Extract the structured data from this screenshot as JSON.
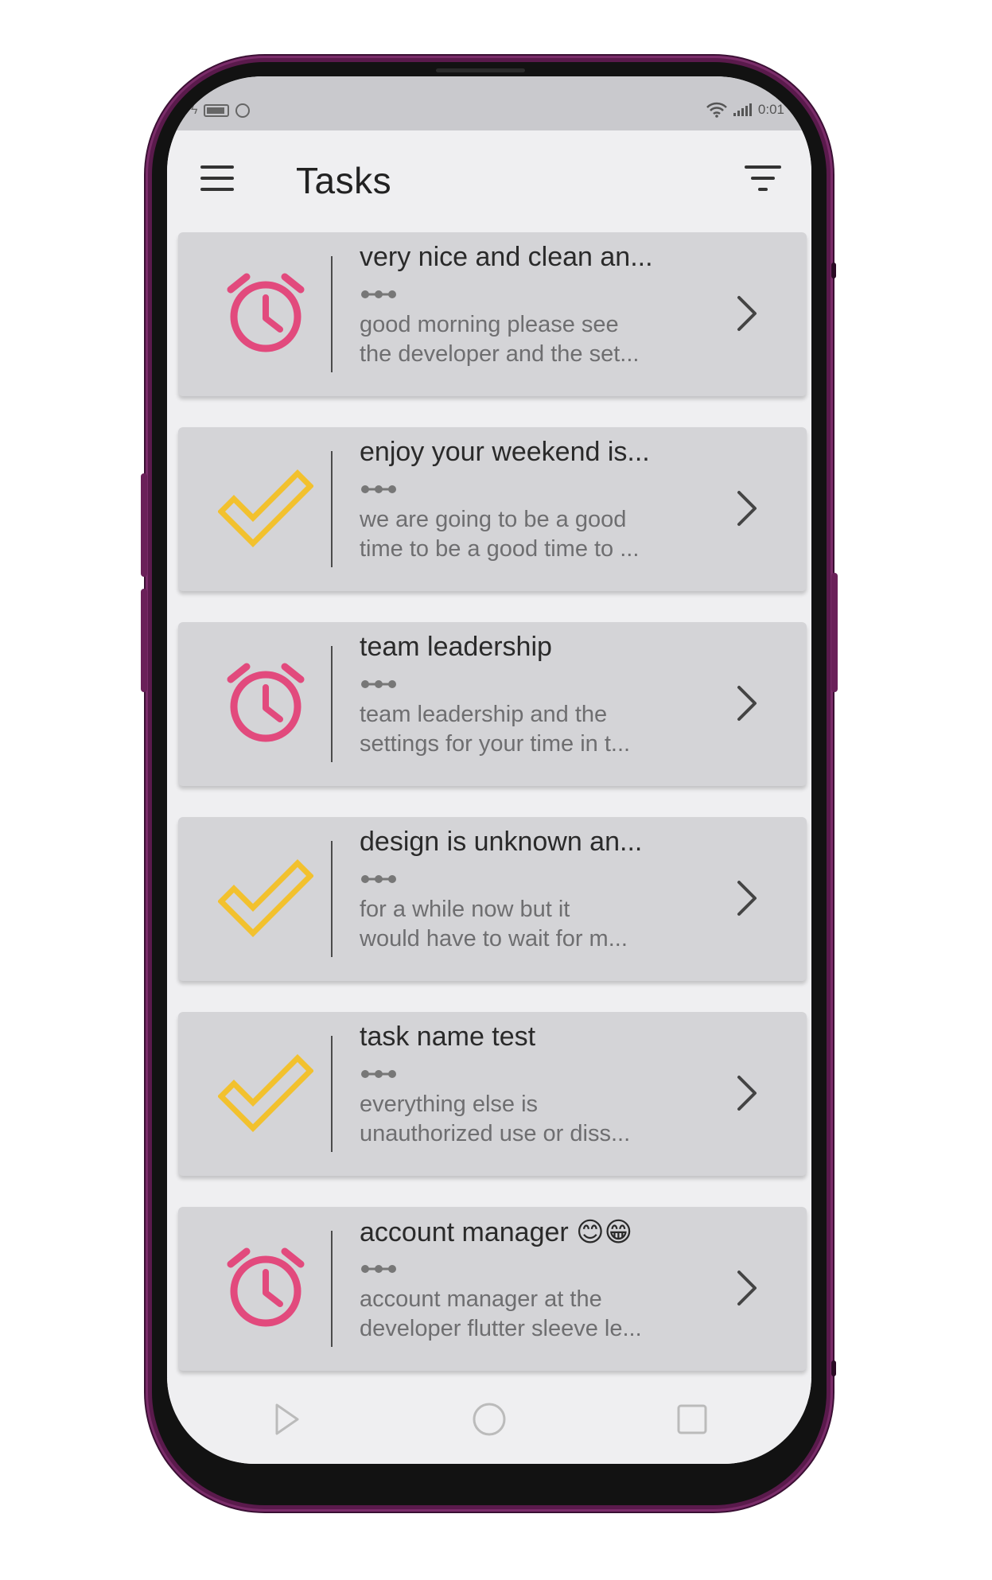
{
  "status_bar": {
    "time": "0:01"
  },
  "app_bar": {
    "title": "Tasks"
  },
  "colors": {
    "alarm": "#e24a7d",
    "check": "#f2c12e",
    "card_bg": "#d4d4d7",
    "frame": "#5a1a4c"
  },
  "tasks": [
    {
      "status_icon": "alarm-clock-icon",
      "title": "very nice and clean an...",
      "desc_line1": "good morning please see",
      "desc_line2": "the developer and the set..."
    },
    {
      "status_icon": "checkmark-icon",
      "title": "enjoy your weekend is...",
      "desc_line1": "we are going to be a good",
      "desc_line2": "time to be a good time to ..."
    },
    {
      "status_icon": "alarm-clock-icon",
      "title": "team leadership",
      "desc_line1": "team leadership and the",
      "desc_line2": "settings for your time in t..."
    },
    {
      "status_icon": "checkmark-icon",
      "title": "design is unknown an...",
      "desc_line1": "for a while now but it",
      "desc_line2": "would have to wait for m..."
    },
    {
      "status_icon": "checkmark-icon",
      "title": "task name test",
      "desc_line1": "everything else is",
      "desc_line2": "unauthorized use or diss..."
    },
    {
      "status_icon": "alarm-clock-icon",
      "title": "account manager 😊😁",
      "desc_line1": "account manager at the",
      "desc_line2": "developer flutter sleeve le..."
    }
  ],
  "nav_bar": {
    "back_icon": "triangle-back-icon",
    "home_icon": "circle-home-icon",
    "recents_icon": "square-recents-icon"
  }
}
